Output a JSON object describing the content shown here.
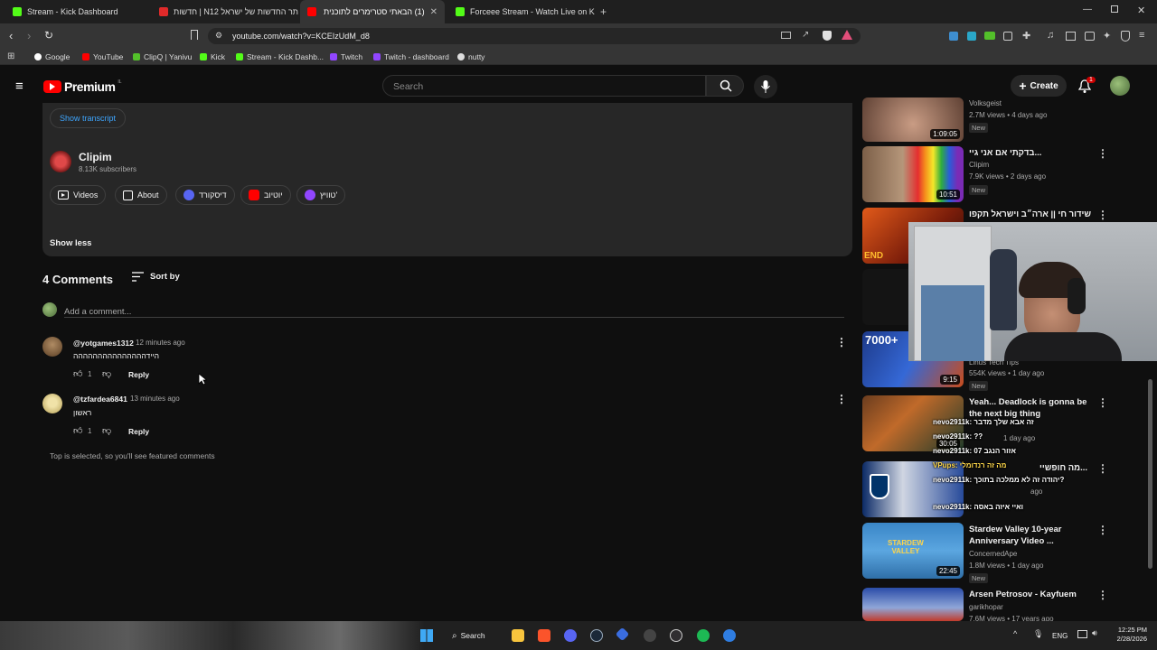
{
  "browser": {
    "tabs": [
      {
        "title": "Stream - Kick Dashboard"
      },
      {
        "title": "חדשות | N12 אתר החדשות של ישראל"
      },
      {
        "title": "(1) הבאתי סטרימרים לתוכנית הג'"
      },
      {
        "title": "Forceee Stream - Watch Live on Kick"
      }
    ],
    "url": "youtube.com/watch?v=KCEIzUdM_d8",
    "bookmarks": [
      "Google",
      "YouTube",
      "ClipQ | Yanivu",
      "Kick",
      "Stream - Kick Dashb...",
      "Twitch",
      "Twitch - dashboard",
      "nutty"
    ]
  },
  "yt_header": {
    "logo_text": "Premium",
    "logo_region": "IL",
    "search_placeholder": "Search",
    "create_label": "Create",
    "notif_count": "1"
  },
  "description": {
    "show_transcript": "Show transcript",
    "channel_name": "Clipim",
    "subscribers": "8.13K subscribers",
    "pills": [
      "Videos",
      "About",
      "דיסקורד",
      "יוטיוב",
      "טוויץ'"
    ],
    "show_less": "Show less"
  },
  "comments": {
    "count_label": "4 Comments",
    "sort_label": "Sort by",
    "add_placeholder": "Add a comment...",
    "items": [
      {
        "author": "@yotgames1312",
        "time": "12 minutes ago",
        "text": "היידההההההההההההההה",
        "likes": "1",
        "reply": "Reply"
      },
      {
        "author": "@tzfardea6841",
        "time": "13 minutes ago",
        "text": "ראשון",
        "likes": "1",
        "reply": "Reply"
      }
    ],
    "footer_note": "Top is selected, so you'll see featured comments"
  },
  "sidebar": {
    "videos": [
      {
        "title": "",
        "channel": "Volksgeist",
        "meta": "2.7M views • 4 days ago",
        "badge": "New",
        "duration": "1:09:05"
      },
      {
        "title": "בדקתי אם אני גיי...",
        "channel": "Clipim",
        "meta": "7.9K views • 2 days ago",
        "badge": "New",
        "duration": "10:51"
      },
      {
        "title": "שידור חי || ארה״ב וישראל תקפו",
        "channel": "",
        "meta": "",
        "badge": "",
        "duration": ""
      },
      {
        "title": "",
        "channel": "Linus Tech Tips",
        "meta": "554K views • 1 day ago",
        "badge": "New",
        "duration": "9:15"
      },
      {
        "title": "Yeah... Deadlock is gonna be the next big thing",
        "channel": "",
        "meta": "1 day ago",
        "badge": "New",
        "duration": "30:05"
      },
      {
        "title": "מה חופשיי...",
        "channel": "",
        "meta": "ago",
        "badge": "New",
        "duration": ""
      },
      {
        "title": "Stardew Valley 10-year Anniversary Video ...",
        "channel": "ConcernedApe",
        "meta": "1.8M views • 1 day ago",
        "badge": "New",
        "duration": "22:45"
      },
      {
        "title": "Arsen Petrosov - Kayfuem",
        "channel": "garikhopar",
        "meta": "7.6M views • 17 years ago",
        "badge": "",
        "duration": ""
      }
    ]
  },
  "chat_overlay": {
    "lines": [
      "nevo2911k: זה אבא שלך מדבר",
      "nevo2911k: ??",
      "nevo2911k: אזור הנגב 07",
      "VPups: מה זה רנדומלי",
      "nevo2911k: יהודה זה לא ממלכה בתוכך?",
      "nevo2911k: ואיי איזה באסה"
    ]
  },
  "taskbar": {
    "search_label": "Search",
    "lang": "ENG",
    "time": "12:25 PM",
    "date": "2/28/2026"
  }
}
